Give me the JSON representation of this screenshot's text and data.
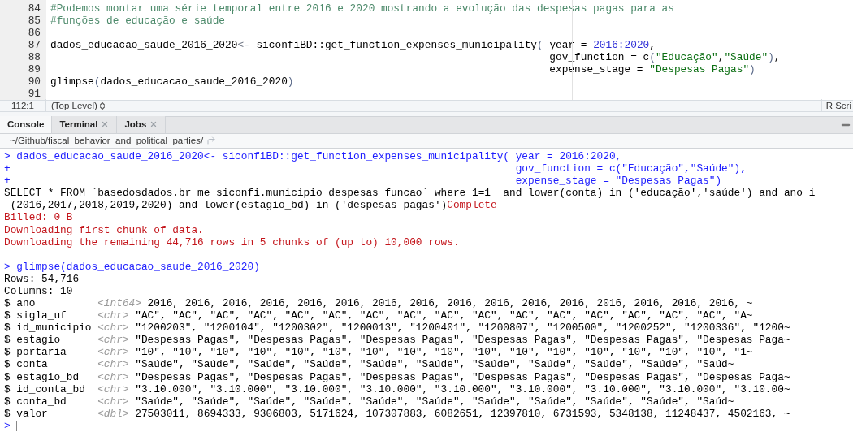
{
  "editor": {
    "lines": [
      {
        "number": "84",
        "tokens": [
          {
            "kind": "comment",
            "text": "#Podemos montar uma série temporal entre 2016 e 2020 mostrando a evolução das despesas pagas para as"
          }
        ]
      },
      {
        "number": "85",
        "tokens": [
          {
            "kind": "comment",
            "text": "#funções de educação e saúde"
          }
        ]
      },
      {
        "number": "86"
      },
      {
        "number": "87",
        "tokens": [
          {
            "kind": "plain",
            "text": "dados_educacao_saude_2016_2020"
          },
          {
            "kind": "op",
            "text": "<-"
          },
          {
            "kind": "plain",
            "text": " siconfiBD::get_function_expenses_municipality"
          },
          {
            "kind": "paren",
            "text": "("
          },
          {
            "kind": "plain",
            "text": " year = "
          },
          {
            "kind": "number",
            "text": "2016:2020"
          },
          {
            "kind": "plain",
            "text": ","
          }
        ]
      },
      {
        "number": "88",
        "continuation": true,
        "tokens": [
          {
            "kind": "plain",
            "text": "gov_function = c"
          },
          {
            "kind": "paren",
            "text": "("
          },
          {
            "kind": "string",
            "text": "\"Educação\""
          },
          {
            "kind": "plain",
            "text": ","
          },
          {
            "kind": "string",
            "text": "\"Saúde\""
          },
          {
            "kind": "paren",
            "text": ")"
          },
          {
            "kind": "plain",
            "text": ","
          }
        ]
      },
      {
        "number": "89",
        "continuation": true,
        "tokens": [
          {
            "kind": "plain",
            "text": "expense_stage = "
          },
          {
            "kind": "string",
            "text": "\"Despesas Pagas\""
          },
          {
            "kind": "paren",
            "text": ")"
          }
        ]
      },
      {
        "number": "90",
        "tokens": [
          {
            "kind": "plain",
            "text": "glimpse"
          },
          {
            "kind": "paren",
            "text": "("
          },
          {
            "kind": "plain",
            "text": "dados_educacao_saude_2016_2020"
          },
          {
            "kind": "paren",
            "text": ")"
          }
        ]
      },
      {
        "number": "91"
      }
    ],
    "status": {
      "position": "112:1",
      "scope": "(Top Level)",
      "file_type": "R Scri"
    }
  },
  "pane": {
    "tabs": [
      {
        "label": "Console",
        "selected": true,
        "closable": false
      },
      {
        "label": "Terminal",
        "selected": false,
        "closable": true
      },
      {
        "label": "Jobs",
        "selected": false,
        "closable": true
      }
    ],
    "path": "~/Github/fiscal_behavior_and_political_parties/"
  },
  "console": {
    "lines": [
      {
        "prompt": ">",
        "segments": [
          {
            "kind": "input",
            "text": "dados_educacao_saude_2016_2020<- siconfiBD::get_function_expenses_municipality( year = 2016:2020,"
          }
        ]
      },
      {
        "prompt": "+",
        "continuation": true,
        "segments": [
          {
            "kind": "input",
            "text": "gov_function = c(\"Educação\",\"Saúde\"),"
          }
        ]
      },
      {
        "prompt": "+",
        "continuation": true,
        "segments": [
          {
            "kind": "input",
            "text": "expense_stage = \"Despesas Pagas\")"
          }
        ]
      },
      {
        "segments": [
          {
            "kind": "output",
            "text": "SELECT * FROM `basedosdados.br_me_siconfi.municipio_despesas_funcao` where 1=1  and lower(conta) in ('educação','saúde') and ano i"
          }
        ]
      },
      {
        "segments": [
          {
            "kind": "output",
            "text": " (2016,2017,2018,2019,2020) and lower(estagio_bd) in ('despesas pagas')"
          },
          {
            "kind": "message",
            "text": "Complete"
          }
        ]
      },
      {
        "segments": [
          {
            "kind": "message",
            "text": "Billed: 0 B"
          }
        ]
      },
      {
        "segments": [
          {
            "kind": "message",
            "text": "Downloading first chunk of data."
          }
        ]
      },
      {
        "segments": [
          {
            "kind": "message",
            "text": "Downloading the remaining 44,716 rows in 5 chunks of (up to) 10,000 rows."
          }
        ]
      },
      {
        "prompt": ">",
        "spaced": true,
        "segments": [
          {
            "kind": "input",
            "text": "glimpse(dados_educacao_saude_2016_2020)"
          }
        ]
      },
      {
        "segments": [
          {
            "kind": "output",
            "text": "Rows: 54,716"
          }
        ]
      },
      {
        "segments": [
          {
            "kind": "output",
            "text": "Columns: 10"
          }
        ]
      }
    ],
    "glimpse": [
      {
        "marker": "$",
        "name": "ano",
        "type": "<int64>",
        "values": "2016, 2016, 2016, 2016, 2016, 2016, 2016, 2016, 2016, 2016, 2016, 2016, 2016, 2016, 2016, 2016, ~"
      },
      {
        "marker": "$",
        "name": "sigla_uf",
        "type": "<chr>",
        "values": "\"AC\", \"AC\", \"AC\", \"AC\", \"AC\", \"AC\", \"AC\", \"AC\", \"AC\", \"AC\", \"AC\", \"AC\", \"AC\", \"AC\", \"AC\", \"AC\", \"A~"
      },
      {
        "marker": "$",
        "name": "id_municipio",
        "type": "<chr>",
        "values": "\"1200203\", \"1200104\", \"1200302\", \"1200013\", \"1200401\", \"1200807\", \"1200500\", \"1200252\", \"1200336\", \"1200~"
      },
      {
        "marker": "$",
        "name": "estagio",
        "type": "<chr>",
        "values": "\"Despesas Pagas\", \"Despesas Pagas\", \"Despesas Pagas\", \"Despesas Pagas\", \"Despesas Pagas\", \"Despesas Paga~"
      },
      {
        "marker": "$",
        "name": "portaria",
        "type": "<chr>",
        "values": "\"10\", \"10\", \"10\", \"10\", \"10\", \"10\", \"10\", \"10\", \"10\", \"10\", \"10\", \"10\", \"10\", \"10\", \"10\", \"10\", \"1~"
      },
      {
        "marker": "$",
        "name": "conta",
        "type": "<chr>",
        "values": "\"Saúde\", \"Saúde\", \"Saúde\", \"Saúde\", \"Saúde\", \"Saúde\", \"Saúde\", \"Saúde\", \"Saúde\", \"Saúde\", \"Saúd~"
      },
      {
        "marker": "$",
        "name": "estagio_bd",
        "type": "<chr>",
        "values": "\"Despesas Pagas\", \"Despesas Pagas\", \"Despesas Pagas\", \"Despesas Pagas\", \"Despesas Pagas\", \"Despesas Paga~"
      },
      {
        "marker": "$",
        "name": "id_conta_bd",
        "type": "<chr>",
        "values": "\"3.10.000\", \"3.10.000\", \"3.10.000\", \"3.10.000\", \"3.10.000\", \"3.10.000\", \"3.10.000\", \"3.10.000\", \"3.10.00~"
      },
      {
        "marker": "$",
        "name": "conta_bd",
        "type": "<chr>",
        "values": "\"Saúde\", \"Saúde\", \"Saúde\", \"Saúde\", \"Saúde\", \"Saúde\", \"Saúde\", \"Saúde\", \"Saúde\", \"Saúde\", \"Saúd~"
      },
      {
        "marker": "$",
        "name": "valor",
        "type": "<dbl>",
        "values": "27503011, 8694333, 9306803, 5171624, 107307883, 6082651, 12397810, 6731593, 5348138, 11248437, 4502163, ~"
      }
    ],
    "prompt": ">"
  }
}
